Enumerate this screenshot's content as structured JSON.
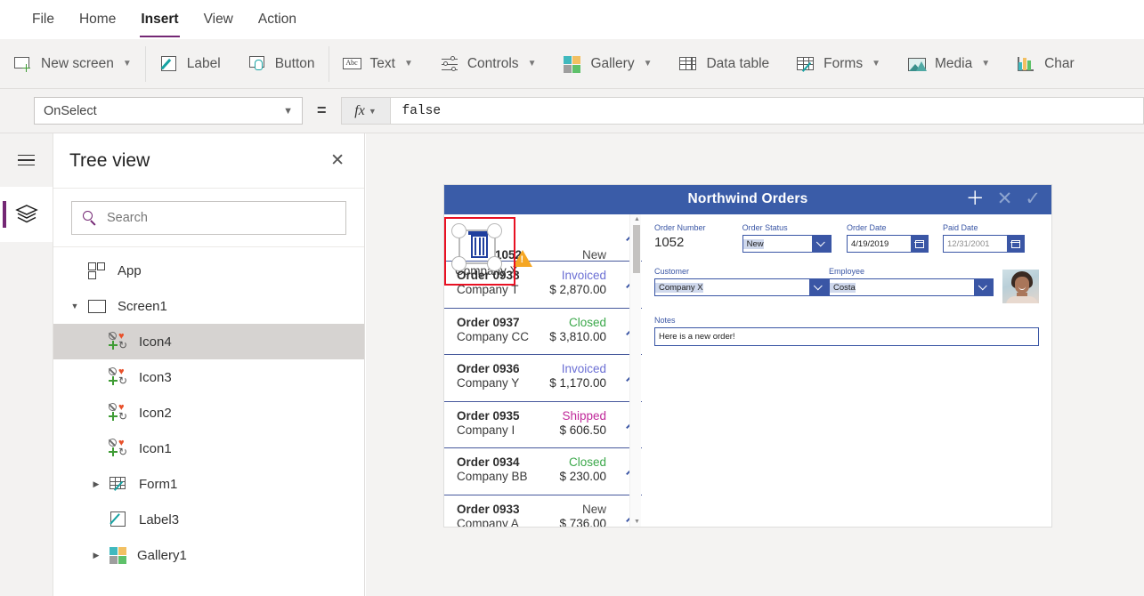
{
  "menubar": {
    "items": [
      {
        "label": "File",
        "active": false
      },
      {
        "label": "Home",
        "active": false
      },
      {
        "label": "Insert",
        "active": true
      },
      {
        "label": "View",
        "active": false
      },
      {
        "label": "Action",
        "active": false
      }
    ]
  },
  "ribbon": {
    "items": [
      {
        "label": "New screen",
        "icon": "new-screen-icon",
        "chevron": true
      },
      {
        "label": "Label",
        "icon": "label-icon",
        "chevron": false
      },
      {
        "label": "Button",
        "icon": "button-icon",
        "chevron": false
      },
      {
        "label": "Text",
        "icon": "text-abc-icon",
        "chevron": true
      },
      {
        "label": "Controls",
        "icon": "sliders-icon",
        "chevron": true
      },
      {
        "label": "Gallery",
        "icon": "gallery-squares-icon",
        "chevron": true
      },
      {
        "label": "Data table",
        "icon": "data-table-icon",
        "chevron": false
      },
      {
        "label": "Forms",
        "icon": "forms-icon",
        "chevron": true
      },
      {
        "label": "Media",
        "icon": "media-image-icon",
        "chevron": true
      },
      {
        "label": "Char",
        "icon": "charts-icon",
        "chevron": false
      }
    ]
  },
  "formula_bar": {
    "property": "OnSelect",
    "equals": "=",
    "fx_label": "fx",
    "value": "false"
  },
  "rail": {
    "hamburger": "hamburger-menu-icon",
    "active_item": "tree-view-layers-icon"
  },
  "tree_panel": {
    "title": "Tree view",
    "close_label": "✕",
    "search": {
      "placeholder": "Search",
      "value": ""
    },
    "items": [
      {
        "label": "App",
        "icon": "app-icon",
        "indent": 0,
        "twisty": "",
        "selected": false
      },
      {
        "label": "Screen1",
        "icon": "screen-icon",
        "indent": 0,
        "twisty": "▼",
        "selected": false
      },
      {
        "label": "Icon4",
        "icon": "icon-control-icon",
        "indent": 1,
        "twisty": "",
        "selected": true
      },
      {
        "label": "Icon3",
        "icon": "icon-control-icon",
        "indent": 1,
        "twisty": "",
        "selected": false
      },
      {
        "label": "Icon2",
        "icon": "icon-control-icon",
        "indent": 1,
        "twisty": "",
        "selected": false
      },
      {
        "label": "Icon1",
        "icon": "icon-control-icon",
        "indent": 1,
        "twisty": "",
        "selected": false
      },
      {
        "label": "Form1",
        "icon": "form-icon",
        "indent": 1,
        "twisty": "▶",
        "selected": false
      },
      {
        "label": "Label3",
        "icon": "label-control-icon",
        "indent": 1,
        "twisty": "",
        "selected": false
      },
      {
        "label": "Gallery1",
        "icon": "gallery-control-icon",
        "indent": 1,
        "twisty": "▶",
        "selected": false
      }
    ]
  },
  "canvas": {
    "app": {
      "title": "Northwind Orders",
      "header_actions": [
        {
          "name": "add-icon",
          "glyph": "＋"
        },
        {
          "name": "cancel-icon",
          "glyph": "✕"
        },
        {
          "name": "confirm-icon",
          "glyph": "✓"
        }
      ],
      "gallery": {
        "selected_row": {
          "order": "1052",
          "company": "Company X",
          "status": "New",
          "amount": "",
          "has_warning": true
        },
        "rows": [
          {
            "order": "Order 0938",
            "company": "Company T",
            "status": "Invoiced",
            "status_class": "st-invoiced",
            "amount": "$ 2,870.00"
          },
          {
            "order": "Order 0937",
            "company": "Company CC",
            "status": "Closed",
            "status_class": "st-closed",
            "amount": "$ 3,810.00"
          },
          {
            "order": "Order 0936",
            "company": "Company Y",
            "status": "Invoiced",
            "status_class": "st-invoiced",
            "amount": "$ 1,170.00"
          },
          {
            "order": "Order 0935",
            "company": "Company I",
            "status": "Shipped",
            "status_class": "st-shipped",
            "amount": "$ 606.50"
          },
          {
            "order": "Order 0934",
            "company": "Company BB",
            "status": "Closed",
            "status_class": "st-closed",
            "amount": "$ 230.00"
          },
          {
            "order": "Order 0933",
            "company": "Company A",
            "status": "New",
            "status_class": "st-new",
            "amount": "$ 736.00"
          }
        ]
      },
      "form": {
        "order_number": {
          "label": "Order Number",
          "value": "1052"
        },
        "order_status": {
          "label": "Order Status",
          "value": "New"
        },
        "order_date": {
          "label": "Order Date",
          "value": "4/19/2019"
        },
        "paid_date": {
          "label": "Paid Date",
          "value": "12/31/2001"
        },
        "customer": {
          "label": "Customer",
          "value": "Company X"
        },
        "employee": {
          "label": "Employee",
          "value": "Costa"
        },
        "notes": {
          "label": "Notes",
          "value": "Here is a new order!"
        },
        "employee_photo": "employee-photo"
      }
    }
  },
  "colors": {
    "accent_purple": "#742774",
    "app_header_blue": "#3a5ca8",
    "form_border_blue": "#3a56a5",
    "selection_red": "#e81123",
    "warning_amber": "#f5a623",
    "status_invoiced": "#6b6fd4",
    "status_closed": "#3ba84a",
    "status_shipped": "#c0299a"
  }
}
